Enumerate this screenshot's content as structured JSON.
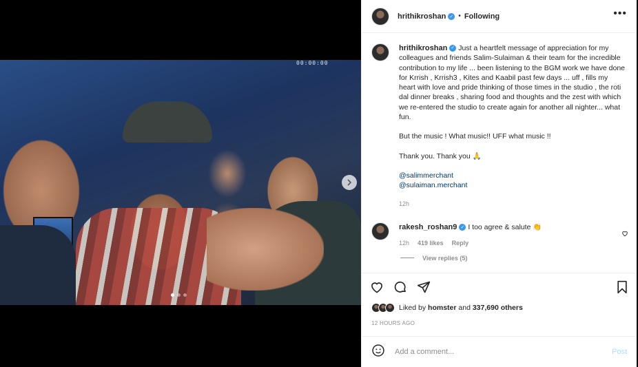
{
  "post": {
    "author": "hrithikroshan",
    "follow_status": "Following",
    "separator": "•",
    "more_icon": "more-horizontal-icon"
  },
  "media": {
    "clock_text": "00:00:00",
    "carousel_count": 3,
    "active_index": 0
  },
  "caption": {
    "username": "hrithikroshan",
    "text1": "Just a heartfelt message of appreciation for my colleagues and friends Salim-Sulaiman & their team for the incredible contribution to my life ... been listening to the BGM work we have done for Krrish , Krrish3 , Kites and Kaabil past few days ... uff , fills my heart with love and pride thinking of those times in the studio , the roti dal dinner breaks , sharing food and thoughts and the zest with which we re-entered the studio to create again for another all nighter... what fun.",
    "text2": "But the music ! What music!! UFF what music !!",
    "text3": "Thank you. Thank you 🙏",
    "tag1": "@salimmerchant",
    "tag2": "@sulaiman.merchant",
    "time": "12h"
  },
  "comment": {
    "username": "rakesh_roshan9",
    "text": "I too agree & salute 👏",
    "time": "12h",
    "likes": "419 likes",
    "reply_label": "Reply",
    "view_replies": "View replies (5)"
  },
  "likes": {
    "prefix": "Liked by",
    "user": "homster",
    "connector": "and",
    "others": "337,690 others"
  },
  "posted_at": "12 HOURS AGO",
  "add_comment": {
    "placeholder": "Add a comment...",
    "post_label": "Post"
  }
}
